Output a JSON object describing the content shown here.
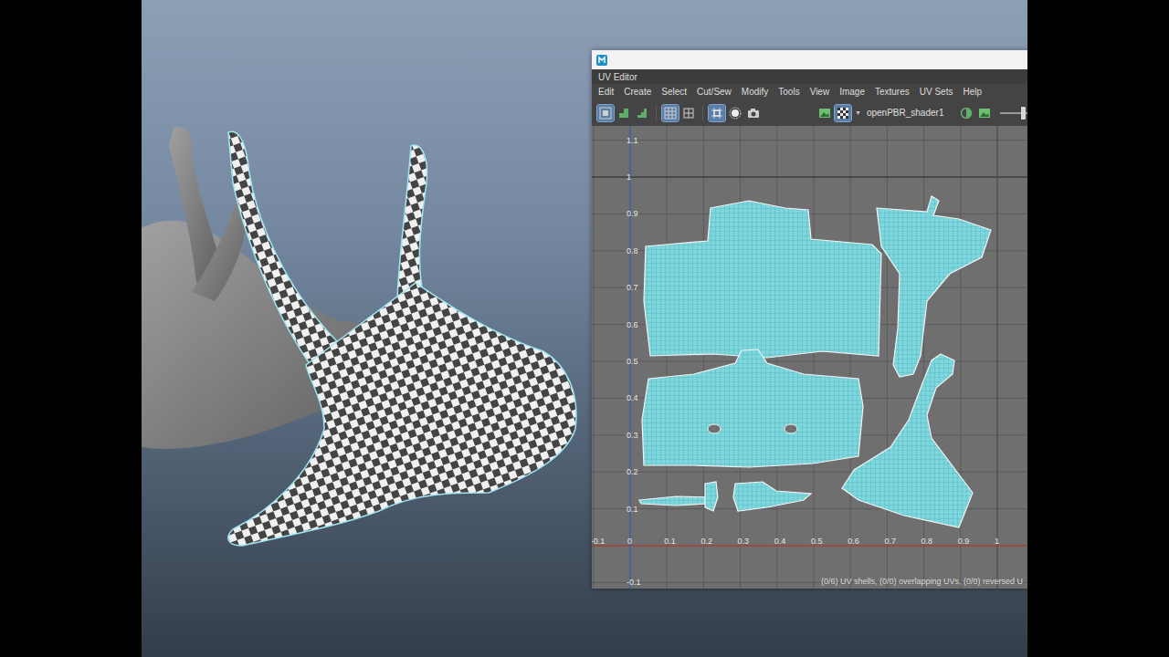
{
  "window": {
    "tab": "UV Editor"
  },
  "menu": [
    "Edit",
    "Create",
    "Select",
    "Cut/Sew",
    "Modify",
    "Tools",
    "View",
    "Image",
    "Textures",
    "UV Sets",
    "Help"
  ],
  "toolbar": {
    "tools": [
      {
        "kind": "select",
        "selected": true
      },
      {
        "kind": "shell",
        "selected": false
      },
      {
        "kind": "stairs",
        "selected": false
      },
      {
        "kind": "grid",
        "selected": true
      },
      {
        "kind": "frame",
        "selected": false
      },
      {
        "kind": "lattice",
        "selected": true
      },
      {
        "kind": "sphere",
        "selected": false
      },
      {
        "kind": "camera",
        "selected": false
      }
    ],
    "image_tools": [
      {
        "kind": "image",
        "selected": false
      },
      {
        "kind": "checker",
        "selected": true
      }
    ],
    "shader": "openPBR_shader1",
    "slider": {
      "level": 0.5
    }
  },
  "axis": {
    "v_labels": [
      "1.1",
      "1",
      "0.9",
      "0.8",
      "0.7",
      "0.6",
      "0.5",
      "0.4",
      "0.3",
      "0.2",
      "0.1",
      "-0.1"
    ],
    "u_labels": [
      "-0.1",
      "0",
      "0.1",
      "0.2",
      "0.3",
      "0.4",
      "0.5",
      "0.6",
      "0.7",
      "0.8",
      "0.9",
      "1"
    ]
  },
  "status": "(0/6) UV shells, (0/0) overlapping UVs, (0/0) reversed U"
}
